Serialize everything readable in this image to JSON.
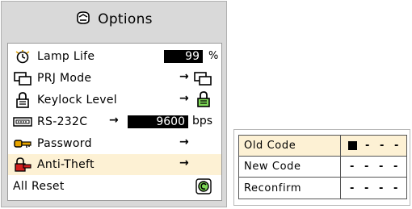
{
  "panel": {
    "title": "Options",
    "title_icon": "options-icon"
  },
  "menu": {
    "items": [
      {
        "label": "Lamp Life",
        "icon": "hourglass-icon",
        "value": "99",
        "unit": "%"
      },
      {
        "label": "PRJ Mode",
        "icon": "prj-mode-icon",
        "arrow": "→"
      },
      {
        "label": "Keylock Level",
        "icon": "keylock-icon",
        "arrow": "→"
      },
      {
        "label": "RS-232C",
        "icon": "rs232c-icon",
        "arrow": "→",
        "value": "9600",
        "unit": "bps"
      },
      {
        "label": "Password",
        "icon": "key-icon",
        "arrow": "→"
      },
      {
        "label": "Anti-Theft",
        "icon": "anti-theft-icon",
        "arrow": "→",
        "selected": true
      },
      {
        "label": "All Reset",
        "icon": "reset-icon"
      }
    ]
  },
  "code_panel": {
    "rows": [
      {
        "label": "Old Code",
        "digits": [
          "",
          "-",
          "-",
          "-"
        ],
        "cursor_index": 0
      },
      {
        "label": "New Code",
        "digits": [
          "-",
          "-",
          "-",
          "-"
        ]
      },
      {
        "label": "Reconfirm",
        "digits": [
          "-",
          "-",
          "-",
          "-"
        ]
      }
    ]
  },
  "colors": {
    "panel_bg": "#d9d9d9",
    "highlight": "#fdf1d4",
    "value_box": "#000000"
  }
}
